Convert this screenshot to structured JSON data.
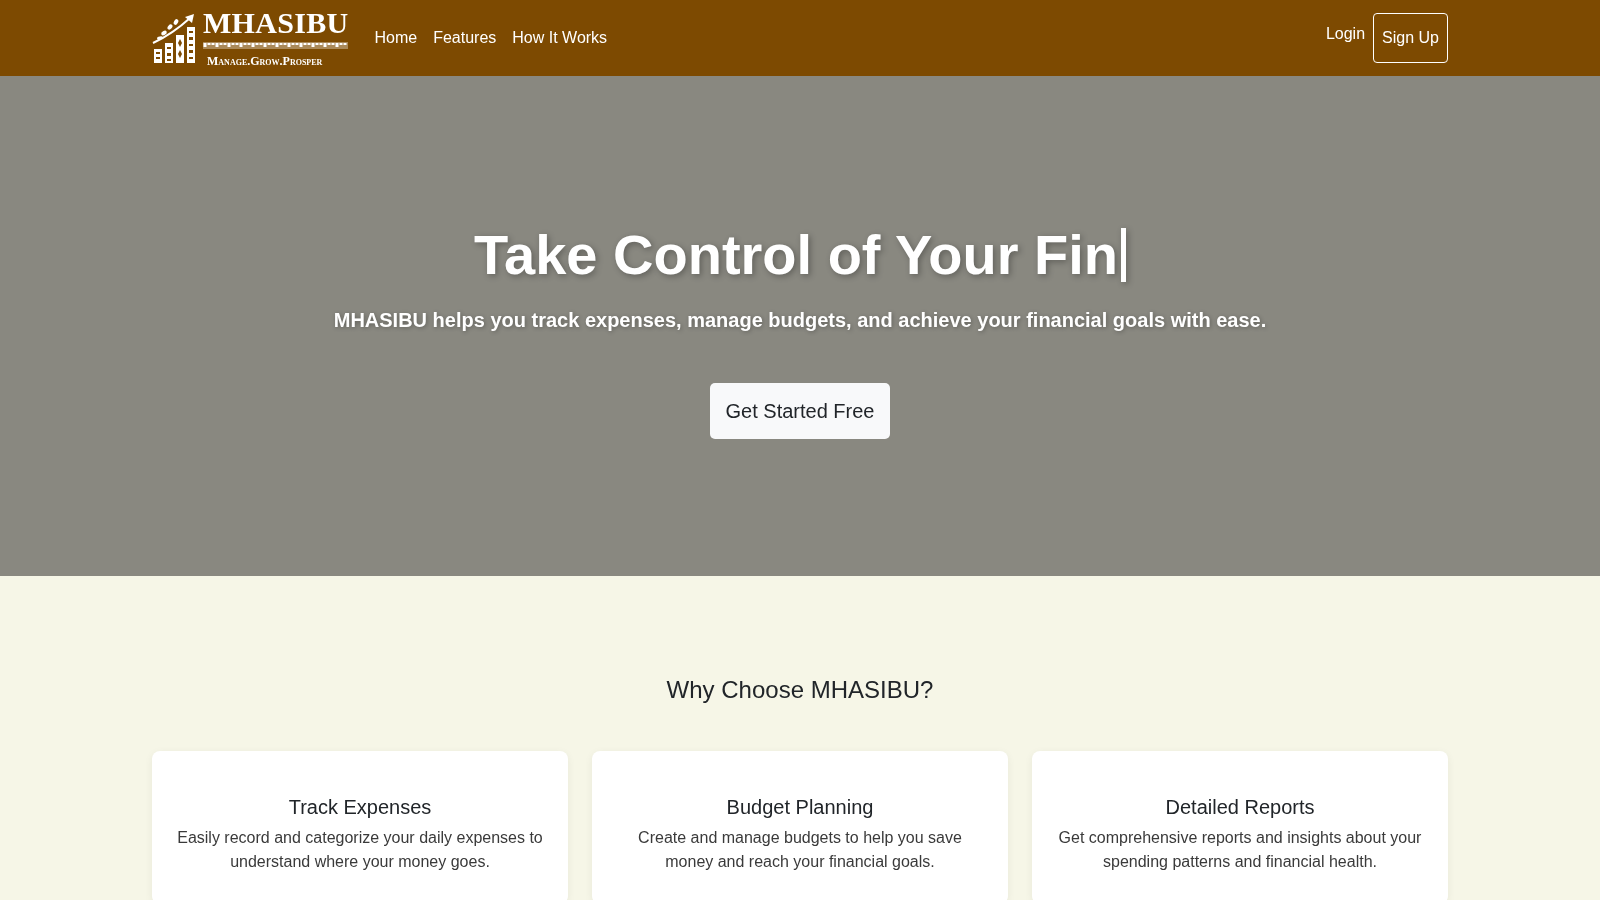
{
  "navbar": {
    "logo": {
      "name": "MHASIBU",
      "tagline": "Manage.Grow.Prosper"
    },
    "links": [
      {
        "label": "Home"
      },
      {
        "label": "Features"
      },
      {
        "label": "How It Works"
      }
    ],
    "login": "Login",
    "signup": "Sign Up"
  },
  "hero": {
    "title": "Take Control of Your Fin",
    "subtitle": "MHASIBU helps you track expenses, manage budgets, and achieve your financial goals with ease.",
    "cta": "Get Started Free"
  },
  "features": {
    "heading": "Why Choose MHASIBU?",
    "cards": [
      {
        "title": "Track Expenses",
        "description": "Easily record and categorize your daily expenses to understand where your money goes."
      },
      {
        "title": "Budget Planning",
        "description": "Create and manage budgets to help you save money and reach your financial goals."
      },
      {
        "title": "Detailed Reports",
        "description": "Get comprehensive reports and insights about your spending patterns and financial health."
      }
    ]
  }
}
